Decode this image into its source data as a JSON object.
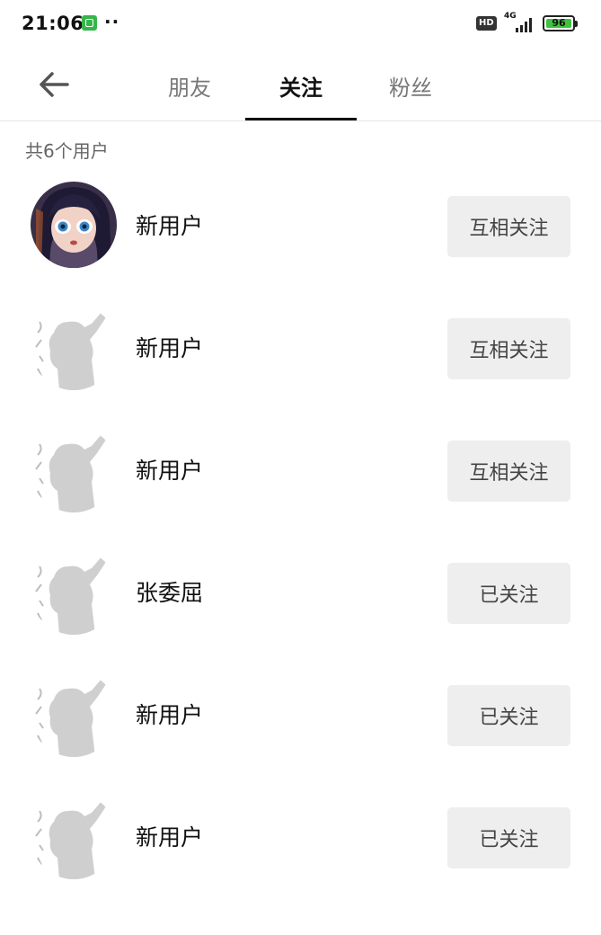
{
  "status_bar": {
    "time": "21:06",
    "dots": "··",
    "hd": "HD",
    "network": "4G",
    "battery": "96"
  },
  "nav": {
    "tabs": [
      "朋友",
      "关注",
      "粉丝"
    ]
  },
  "count_label": "共6个用户",
  "users": [
    {
      "name": "新用户",
      "avatar": "anime-girl-avatar",
      "button": "互相关注"
    },
    {
      "name": "新用户",
      "avatar": "default-silhouette-avatar",
      "button": "互相关注"
    },
    {
      "name": "新用户",
      "avatar": "default-silhouette-avatar",
      "button": "互相关注"
    },
    {
      "name": "张委屈",
      "avatar": "default-silhouette-avatar",
      "button": "已关注"
    },
    {
      "name": "新用户",
      "avatar": "default-silhouette-avatar",
      "button": "已关注"
    },
    {
      "name": "新用户",
      "avatar": "default-silhouette-avatar",
      "button": "已关注"
    }
  ]
}
